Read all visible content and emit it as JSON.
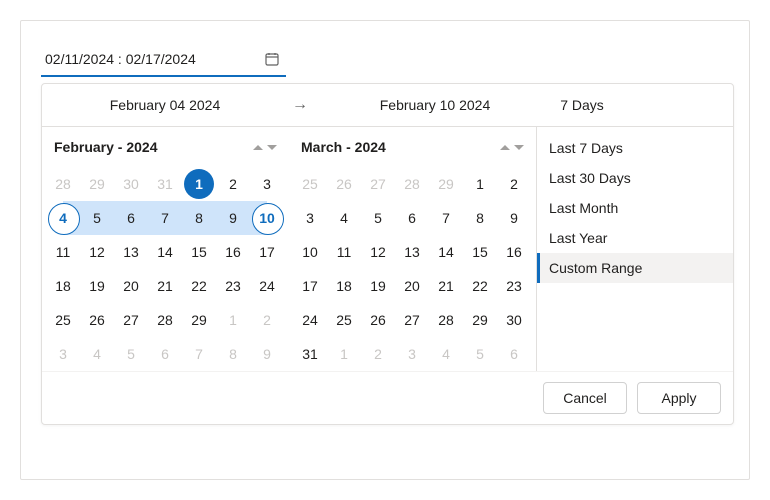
{
  "input": {
    "text": "02/11/2024 : 02/17/2024"
  },
  "summary": {
    "start": "February 04 2024",
    "end": "February 10 2024",
    "days": "7 Days"
  },
  "calLeft": {
    "title": "February - 2024",
    "cells": [
      {
        "d": "28",
        "cls": "dim"
      },
      {
        "d": "29",
        "cls": "dim"
      },
      {
        "d": "30",
        "cls": "dim"
      },
      {
        "d": "31",
        "cls": "dim"
      },
      {
        "d": "1",
        "cls": "sel-solid"
      },
      {
        "d": "2",
        "cls": ""
      },
      {
        "d": "3",
        "cls": ""
      },
      {
        "d": "4",
        "cls": "sel-outline range-start"
      },
      {
        "d": "5",
        "cls": "range"
      },
      {
        "d": "6",
        "cls": "range"
      },
      {
        "d": "7",
        "cls": "range"
      },
      {
        "d": "8",
        "cls": "range"
      },
      {
        "d": "9",
        "cls": "range"
      },
      {
        "d": "10",
        "cls": "sel-outline range-end"
      },
      {
        "d": "11",
        "cls": ""
      },
      {
        "d": "12",
        "cls": ""
      },
      {
        "d": "13",
        "cls": ""
      },
      {
        "d": "14",
        "cls": ""
      },
      {
        "d": "15",
        "cls": ""
      },
      {
        "d": "16",
        "cls": ""
      },
      {
        "d": "17",
        "cls": ""
      },
      {
        "d": "18",
        "cls": ""
      },
      {
        "d": "19",
        "cls": ""
      },
      {
        "d": "20",
        "cls": ""
      },
      {
        "d": "21",
        "cls": ""
      },
      {
        "d": "22",
        "cls": ""
      },
      {
        "d": "23",
        "cls": ""
      },
      {
        "d": "24",
        "cls": ""
      },
      {
        "d": "25",
        "cls": ""
      },
      {
        "d": "26",
        "cls": ""
      },
      {
        "d": "27",
        "cls": ""
      },
      {
        "d": "28",
        "cls": ""
      },
      {
        "d": "29",
        "cls": ""
      },
      {
        "d": "1",
        "cls": "dim"
      },
      {
        "d": "2",
        "cls": "dim"
      },
      {
        "d": "3",
        "cls": "dim"
      },
      {
        "d": "4",
        "cls": "dim"
      },
      {
        "d": "5",
        "cls": "dim"
      },
      {
        "d": "6",
        "cls": "dim"
      },
      {
        "d": "7",
        "cls": "dim"
      },
      {
        "d": "8",
        "cls": "dim"
      },
      {
        "d": "9",
        "cls": "dim"
      }
    ]
  },
  "calRight": {
    "title": "March - 2024",
    "cells": [
      {
        "d": "25",
        "cls": "dim"
      },
      {
        "d": "26",
        "cls": "dim"
      },
      {
        "d": "27",
        "cls": "dim"
      },
      {
        "d": "28",
        "cls": "dim"
      },
      {
        "d": "29",
        "cls": "dim"
      },
      {
        "d": "1",
        "cls": ""
      },
      {
        "d": "2",
        "cls": ""
      },
      {
        "d": "3",
        "cls": ""
      },
      {
        "d": "4",
        "cls": ""
      },
      {
        "d": "5",
        "cls": ""
      },
      {
        "d": "6",
        "cls": ""
      },
      {
        "d": "7",
        "cls": ""
      },
      {
        "d": "8",
        "cls": ""
      },
      {
        "d": "9",
        "cls": ""
      },
      {
        "d": "10",
        "cls": ""
      },
      {
        "d": "11",
        "cls": ""
      },
      {
        "d": "12",
        "cls": ""
      },
      {
        "d": "13",
        "cls": ""
      },
      {
        "d": "14",
        "cls": ""
      },
      {
        "d": "15",
        "cls": ""
      },
      {
        "d": "16",
        "cls": ""
      },
      {
        "d": "17",
        "cls": ""
      },
      {
        "d": "18",
        "cls": ""
      },
      {
        "d": "19",
        "cls": ""
      },
      {
        "d": "20",
        "cls": ""
      },
      {
        "d": "21",
        "cls": ""
      },
      {
        "d": "22",
        "cls": ""
      },
      {
        "d": "23",
        "cls": ""
      },
      {
        "d": "24",
        "cls": ""
      },
      {
        "d": "25",
        "cls": ""
      },
      {
        "d": "26",
        "cls": ""
      },
      {
        "d": "27",
        "cls": ""
      },
      {
        "d": "28",
        "cls": ""
      },
      {
        "d": "29",
        "cls": ""
      },
      {
        "d": "30",
        "cls": ""
      },
      {
        "d": "31",
        "cls": ""
      },
      {
        "d": "1",
        "cls": "dim"
      },
      {
        "d": "2",
        "cls": "dim"
      },
      {
        "d": "3",
        "cls": "dim"
      },
      {
        "d": "4",
        "cls": "dim"
      },
      {
        "d": "5",
        "cls": "dim"
      },
      {
        "d": "6",
        "cls": "dim"
      }
    ]
  },
  "presets": [
    {
      "label": "Last 7 Days",
      "active": false
    },
    {
      "label": "Last 30 Days",
      "active": false
    },
    {
      "label": "Last Month",
      "active": false
    },
    {
      "label": "Last Year",
      "active": false
    },
    {
      "label": "Custom Range",
      "active": true
    }
  ],
  "footer": {
    "cancel": "Cancel",
    "apply": "Apply"
  }
}
